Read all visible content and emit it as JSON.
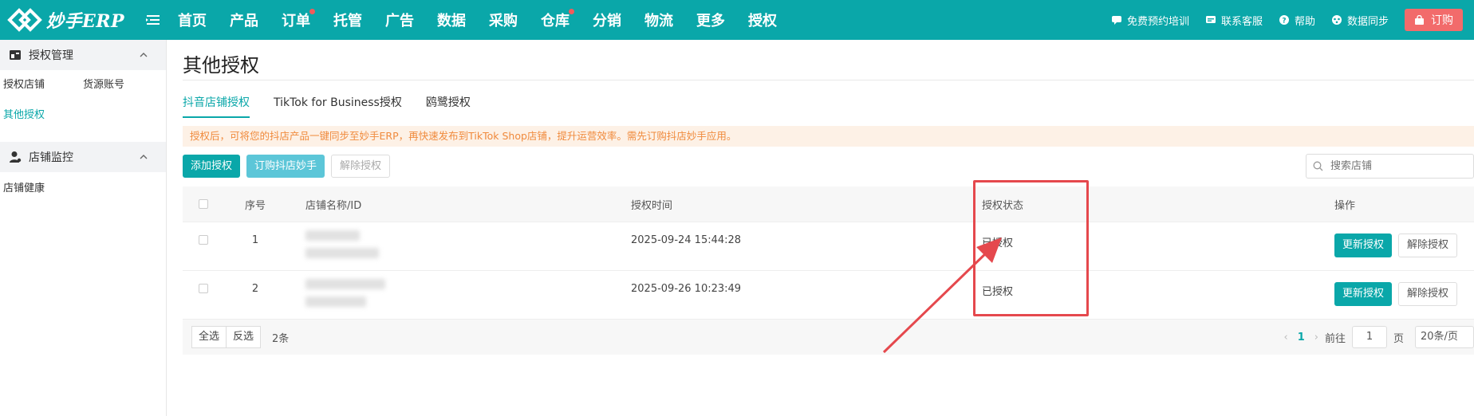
{
  "brand": {
    "logo_text": "妙手ERP"
  },
  "nav": {
    "items": [
      {
        "label": "首页",
        "dot": false
      },
      {
        "label": "产品",
        "dot": false
      },
      {
        "label": "订单",
        "dot": true
      },
      {
        "label": "托管",
        "dot": false
      },
      {
        "label": "广告",
        "dot": false
      },
      {
        "label": "数据",
        "dot": false
      },
      {
        "label": "采购",
        "dot": false
      },
      {
        "label": "仓库",
        "dot": true
      },
      {
        "label": "分销",
        "dot": false
      },
      {
        "label": "物流",
        "dot": false
      },
      {
        "label": "更多",
        "dot": false
      },
      {
        "label": "授权",
        "dot": false
      }
    ]
  },
  "header_links": {
    "training": "免费预约培训",
    "support": "联系客服",
    "help": "帮助",
    "sync": "数据同步",
    "order": "订购"
  },
  "sidebar": {
    "group1": {
      "label": "授权管理",
      "items": [
        "授权店铺",
        "货源账号",
        "其他授权"
      ],
      "active": "其他授权"
    },
    "group2": {
      "label": "店铺监控",
      "items": [
        "店铺健康"
      ]
    }
  },
  "page": {
    "title": "其他授权",
    "tabs": [
      "抖音店铺授权",
      "TikTok for Business授权",
      "鸥鹭授权"
    ],
    "notice": "授权后，可将您的抖店产品一键同步至妙手ERP，再快速发布到TikTok Shop店铺，提升运营效率。需先订购抖店妙手应用。",
    "toolbar": {
      "add": "添加授权",
      "subscribe": "订购抖店妙手",
      "revoke": "解除授权"
    },
    "search_placeholder": "搜索店铺"
  },
  "table": {
    "headers": {
      "no": "序号",
      "name": "店铺名称/ID",
      "time": "授权时间",
      "status": "授权状态",
      "op": "操作"
    },
    "rows": [
      {
        "no": "1",
        "time": "2025-09-24 15:44:28",
        "status": "已授权",
        "update": "更新授权",
        "revoke": "解除授权"
      },
      {
        "no": "2",
        "time": "2025-09-26 10:23:49",
        "status": "已授权",
        "update": "更新授权",
        "revoke": "解除授权"
      }
    ]
  },
  "footer": {
    "select_all": "全选",
    "invert": "反选",
    "count": "2条",
    "page_current": "1",
    "goto_label": "前往",
    "goto_value": "1",
    "page_unit": "页",
    "page_size": "20条/页"
  },
  "colors": {
    "brand": "#0aa7a9",
    "notice_text": "#f08a3c",
    "annotation": "#e5484d",
    "order_button": "#f26b6b"
  }
}
